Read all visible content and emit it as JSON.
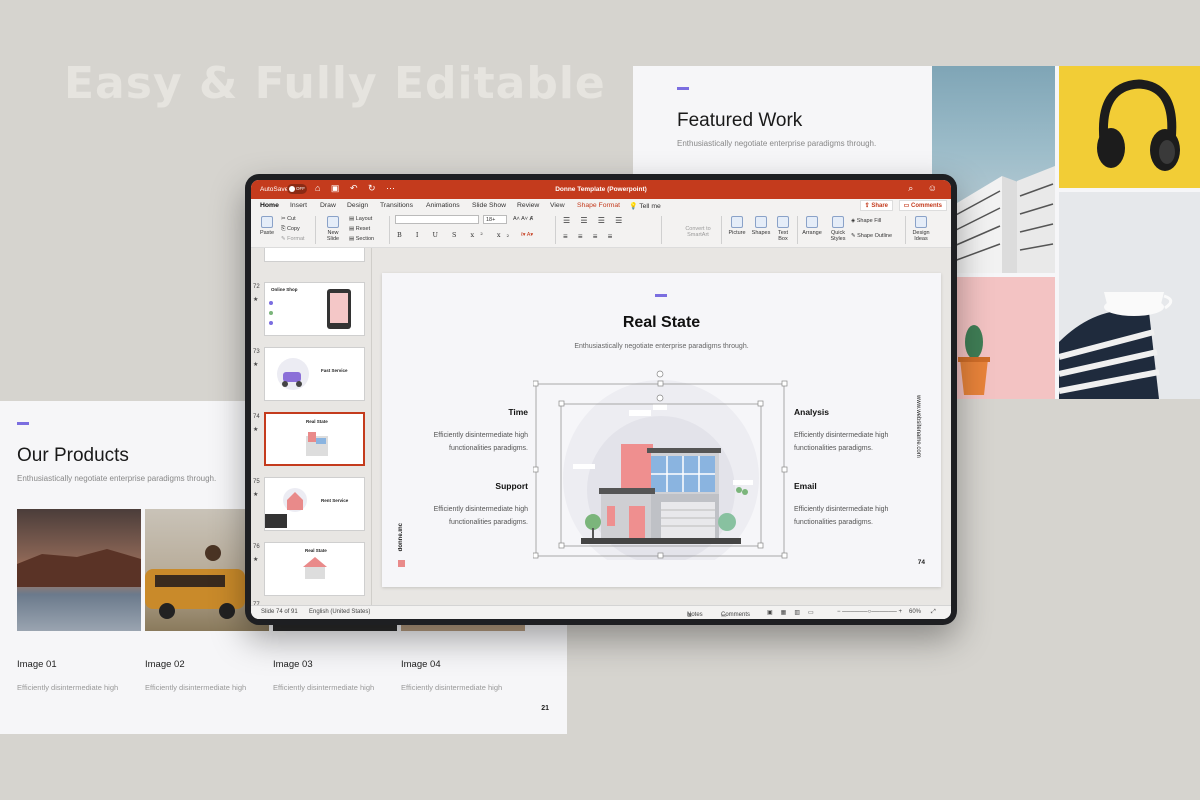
{
  "headline": "Easy & Fully Editable",
  "featured": {
    "title": "Featured Work",
    "subtitle": "Enthusiastically negotiate enterprise paradigms through."
  },
  "products": {
    "title": "Our Products",
    "subtitle": "Enthusiastically negotiate enterprise paradigms through.",
    "items": [
      {
        "name": "Image 01",
        "desc": "Efficiently disintermediate high"
      },
      {
        "name": "Image 02",
        "desc": "Efficiently disintermediate high"
      },
      {
        "name": "Image 03",
        "desc": "Efficiently disintermediate high"
      },
      {
        "name": "Image 04",
        "desc": "Efficiently disintermediate high"
      }
    ],
    "page": "21"
  },
  "app": {
    "autosave": "AutoSave",
    "autosave_state": "OFF",
    "doc_title": "Donne Template (Powerpoint)",
    "tabs": [
      "Home",
      "Insert",
      "Draw",
      "Design",
      "Transitions",
      "Animations",
      "Slide Show",
      "Review",
      "View",
      "Shape Format",
      "Tell me"
    ],
    "share": "Share",
    "comments": "Comments",
    "ribbon": {
      "paste": "Paste",
      "cut": "Cut",
      "copy": "Copy",
      "format": "Format",
      "new_slide": "New Slide",
      "layout": "Layout",
      "reset": "Reset",
      "section": "Section",
      "font_size": "18+",
      "smartart": "Convert to SmartArt",
      "picture": "Picture",
      "shapes": "Shapes",
      "textbox": "Text Box",
      "arrange": "Arrange",
      "quick_styles": "Quick Styles",
      "shape_fill": "Shape Fill",
      "shape_outline": "Shape Outline",
      "design_ideas": "Design Ideas"
    },
    "thumbs": [
      {
        "num": "72",
        "title": "Online Shop"
      },
      {
        "num": "73",
        "title": "Fast Service"
      },
      {
        "num": "74",
        "title": "Real State"
      },
      {
        "num": "75",
        "title": "Rent Service"
      },
      {
        "num": "76",
        "title": "Real State"
      },
      {
        "num": "77",
        "title": ""
      }
    ],
    "slide": {
      "title": "Real State",
      "subtitle": "Enthusiastically negotiate enterprise paradigms through.",
      "features": [
        {
          "title": "Time",
          "desc1": "Efficiently disintermediate high",
          "desc2": "functionalities paradigms."
        },
        {
          "title": "Support",
          "desc1": "Efficiently disintermediate high",
          "desc2": "functionalities paradigms."
        },
        {
          "title": "Analysis",
          "desc1": "Efficiently disintermediate high",
          "desc2": "functionalities paradigms."
        },
        {
          "title": "Email",
          "desc1": "Efficiently disintermediate high",
          "desc2": "functionalities paradigms."
        }
      ],
      "website": "www.websitename.com",
      "brand": "donne.inc",
      "page": "74"
    },
    "status": {
      "slide_info": "Slide 74 of 91",
      "language": "English (United States)",
      "notes": "Notes",
      "comments": "Comments",
      "zoom": "60%"
    }
  },
  "colors": {
    "accent": "#7b6ee0",
    "office_red": "#c43b1d",
    "background": "#d6d4cf"
  }
}
